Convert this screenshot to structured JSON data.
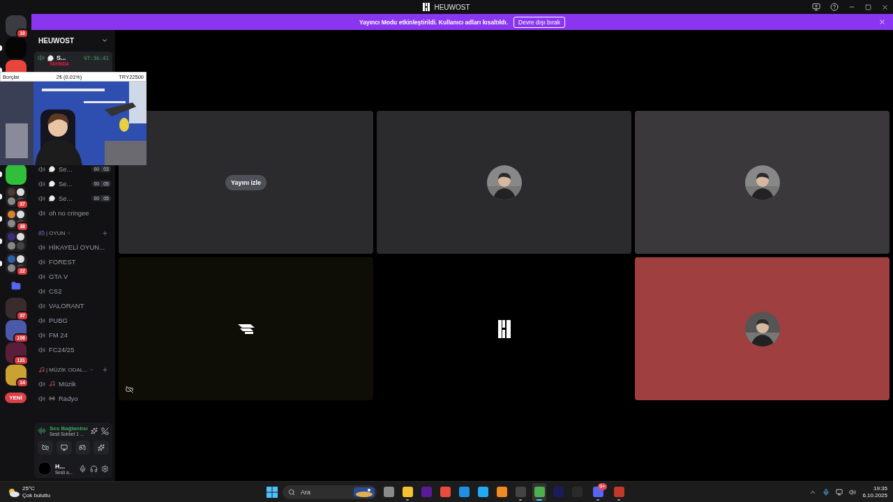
{
  "window": {
    "title": "HEUWOST"
  },
  "banner": {
    "text": "Yayıncı Modu etkinleştirildi. Kullanıcı adları kısaltıldı.",
    "button": "Devre dışı bırak"
  },
  "servers": [
    {
      "kind": "server",
      "color": "#3a3c42",
      "badge": "10",
      "unread": false
    },
    {
      "kind": "server",
      "color": "#050505",
      "unread": true
    },
    {
      "kind": "server",
      "color": "#e8453c",
      "unread": true
    },
    {
      "kind": "server",
      "color": "#2fbf3a",
      "unread": true
    },
    {
      "kind": "group",
      "color": "#4a3a32",
      "badge": "37",
      "unread": true
    },
    {
      "kind": "group",
      "color": "#d9822b",
      "badge": "38",
      "unread": true
    },
    {
      "kind": "group",
      "color": "#3b2a7a",
      "unread": true
    },
    {
      "kind": "group",
      "color": "#2d5fa8",
      "badge": "22",
      "unread": true
    },
    {
      "kind": "folder",
      "color": "#5865f2",
      "unread": false
    },
    {
      "kind": "server",
      "color": "#3a2c2c",
      "badge": "37",
      "unread": false
    },
    {
      "kind": "server",
      "color": "#4a5aa8",
      "badge": "106",
      "unread": false
    },
    {
      "kind": "server",
      "color": "#5a1e3a",
      "badge": "131",
      "unread": false
    },
    {
      "kind": "server",
      "color": "#c9a232",
      "badge": "14",
      "unread": false
    },
    {
      "kind": "new",
      "color": "#d9404a",
      "label": "YENİ"
    }
  ],
  "server_name": "HEUWOST",
  "channels": [
    {
      "kind": "stream",
      "name": "S...",
      "timer": "97:36:41",
      "live": "YAYINDA"
    },
    {
      "kind": "voice",
      "name": "Se...",
      "chat": true,
      "counts": [
        "00",
        "03"
      ]
    },
    {
      "kind": "voice",
      "name": "Se...",
      "chat": true,
      "counts": [
        "00",
        "05"
      ]
    },
    {
      "kind": "voice",
      "name": "Se...",
      "chat": true,
      "counts": [
        "00",
        "05"
      ]
    },
    {
      "kind": "voice",
      "name": "oh no cringee",
      "chat": false
    },
    {
      "kind": "game_category",
      "name": "| OYUN"
    },
    {
      "kind": "voice",
      "name": "HİKAYELİ OYUN...",
      "chat": false
    },
    {
      "kind": "voice",
      "name": "FOREST",
      "chat": false
    },
    {
      "kind": "voice",
      "name": "GTA V",
      "chat": false
    },
    {
      "kind": "voice",
      "name": "CS2",
      "chat": false
    },
    {
      "kind": "voice",
      "name": "VALORANT",
      "chat": false
    },
    {
      "kind": "voice",
      "name": "PUBG",
      "chat": false
    },
    {
      "kind": "voice",
      "name": "FM 24",
      "chat": false
    },
    {
      "kind": "voice",
      "name": "FC24/25",
      "chat": false
    },
    {
      "kind": "music_category",
      "name": "| MÜZİK ODAL..."
    },
    {
      "kind": "music",
      "name": "Müzik",
      "chat": false
    },
    {
      "kind": "radio",
      "name": "Radyo",
      "chat": false
    }
  ],
  "voice_panel": {
    "status": "Ses Bağlantısı",
    "channel": "Sesli Sohbet 1 ..."
  },
  "user": {
    "name": "H...",
    "status": "Sesli a..."
  },
  "overlay": {
    "ticker": [
      "Borçlar",
      "2₺ (0.01%)",
      "TRY22500"
    ]
  },
  "tiles": [
    {
      "kind": "stream",
      "color": "#2b2b2e",
      "button": "Yayını izle",
      "camera_off": false
    },
    {
      "kind": "avatar",
      "color": "#2b2b2e",
      "camera_off": false
    },
    {
      "kind": "avatar",
      "color": "#3a383b",
      "camera_off": false
    },
    {
      "kind": "logo",
      "color": "#0e0d06",
      "camera_off": true
    },
    {
      "kind": "logo",
      "color": "#000000",
      "camera_off": false
    },
    {
      "kind": "avatar",
      "color": "#a03f3f",
      "camera_off": false
    }
  ],
  "taskbar": {
    "weather": {
      "temp": "25°C",
      "desc": "Çok bulutlu"
    },
    "search": {
      "placeholder": "Ara"
    },
    "apps": [
      {
        "color": "#8a8a8a",
        "running": false,
        "selected": false
      },
      {
        "color": "#f4c430",
        "running": true,
        "selected": false
      },
      {
        "color": "#5a1a9a",
        "running": false,
        "selected": false
      },
      {
        "color": "#e74c3c",
        "running": false,
        "selected": false
      },
      {
        "color": "#1f8fe6",
        "running": false,
        "selected": false
      },
      {
        "color": "#23a8f2",
        "running": false,
        "selected": false
      },
      {
        "color": "#f08a24",
        "running": false,
        "selected": false
      },
      {
        "color": "#444444",
        "running": true,
        "selected": false
      },
      {
        "color": "#4caf50",
        "running": true,
        "selected": true
      },
      {
        "color": "#1b1b5e",
        "running": false,
        "selected": false
      },
      {
        "color": "#2a2a2a",
        "running": false,
        "selected": false
      },
      {
        "color": "#5865f2",
        "running": true,
        "selected": false,
        "badge": "9+"
      },
      {
        "color": "#c0392b",
        "running": true,
        "selected": false
      }
    ],
    "time": "19:35",
    "date": "6.10.2025"
  }
}
